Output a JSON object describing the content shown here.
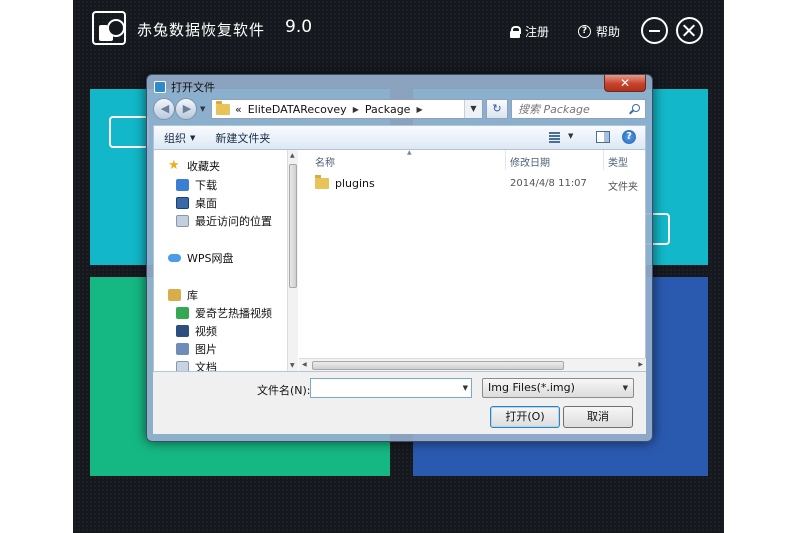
{
  "app": {
    "title": "赤兔数据恢复软件",
    "version": "9.0",
    "register_label": "注册",
    "help_label": "帮助",
    "tile_colors": [
      "#12b8c9",
      "#15b883",
      "#2a5ab0"
    ],
    "background_color": "#15181d"
  },
  "dialog": {
    "title": "打开文件",
    "close_glyph": "✕",
    "address": {
      "prefix": "«",
      "crumbs": [
        "EliteDATARecovey",
        "Package"
      ]
    },
    "search_placeholder": "搜索 Package",
    "toolbar": {
      "organize_label": "组织",
      "new_folder_label": "新建文件夹"
    },
    "nav": {
      "favorites_label": "收藏夹",
      "favorites": [
        "下载",
        "桌面",
        "最近访问的位置"
      ],
      "wps_label": "WPS网盘",
      "library_label": "库",
      "library": [
        "爱奇艺热播视频",
        "视频",
        "图片",
        "文档"
      ]
    },
    "columns": {
      "name": "名称",
      "modified": "修改日期",
      "type": "类型"
    },
    "files": [
      {
        "name": "plugins",
        "modified": "2014/4/8 11:07",
        "type": "文件夹",
        "icon": "folder-icon"
      }
    ],
    "filename_label": "文件名(N):",
    "filename_value": "",
    "filter_value": "Img Files(*.img)",
    "open_label": "打开(O)",
    "cancel_label": "取消"
  }
}
